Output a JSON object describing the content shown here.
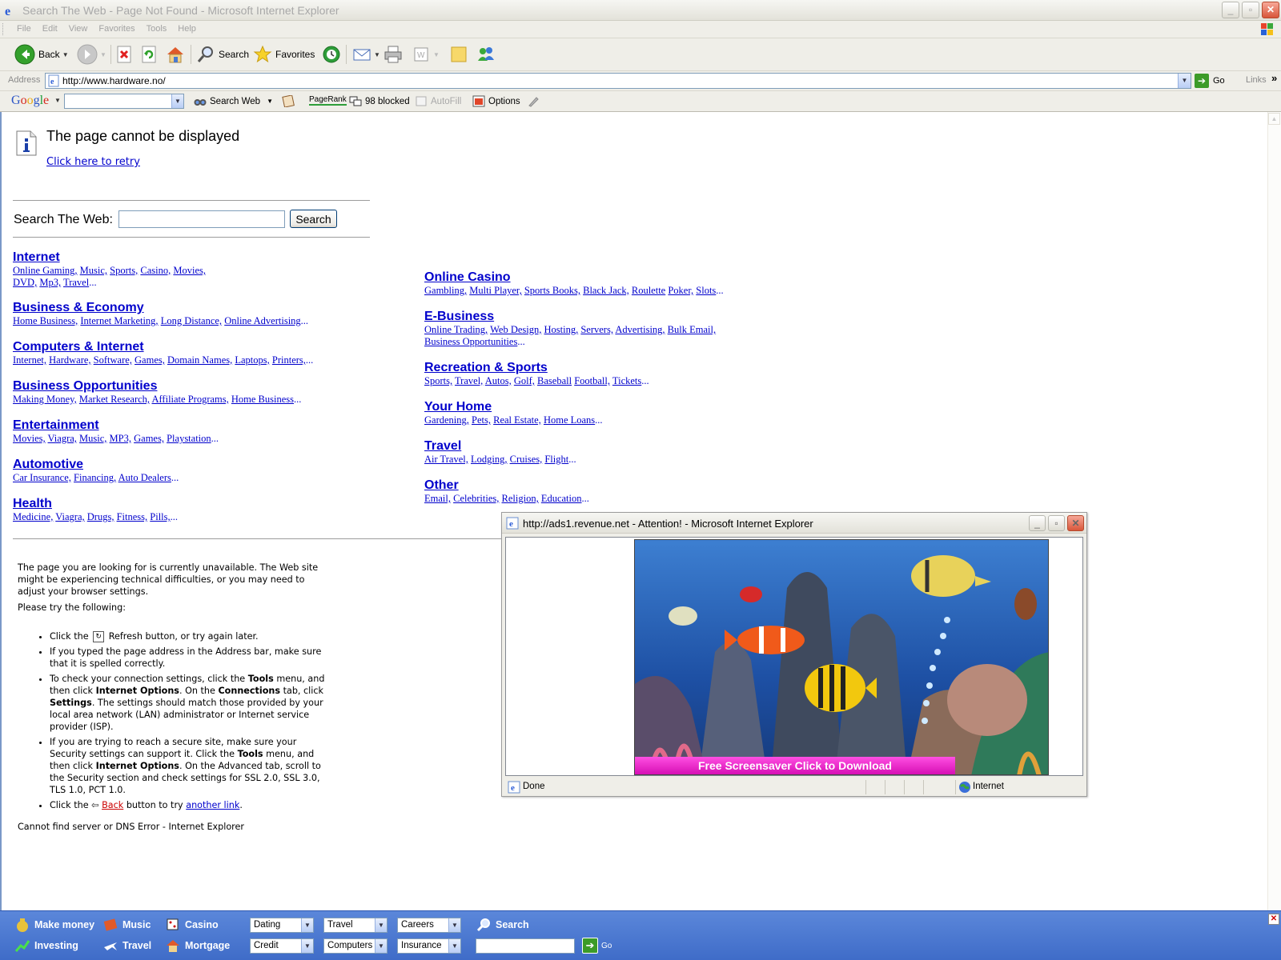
{
  "window": {
    "title": "Search The Web - Page Not Found - Microsoft Internet Explorer"
  },
  "menubar": {
    "items": [
      "File",
      "Edit",
      "View",
      "Favorites",
      "Tools",
      "Help"
    ]
  },
  "toolbar": {
    "back_label": "Back",
    "search_label": "Search",
    "favorites_label": "Favorites"
  },
  "address": {
    "label": "Address",
    "url": "http://www.hardware.no/",
    "go_label": "Go",
    "links_label": "Links"
  },
  "googlebar": {
    "logo": "Google",
    "search_web_label": "Search Web",
    "pagerank_label": "PageRank",
    "blocked_label": "98 blocked",
    "autofill_label": "AutoFill",
    "options_label": "Options"
  },
  "page": {
    "heading": "The page cannot be displayed",
    "retry_link": "Click here to retry",
    "search_label": "Search The Web:",
    "search_button": "Search",
    "categories_left": [
      {
        "title": "Internet",
        "lines": [
          [
            "Online Gaming,",
            "Music,",
            "Sports,",
            "Casino,",
            "Movies,"
          ],
          [
            "DVD,",
            "Mp3,",
            "Travel"
          ]
        ]
      },
      {
        "title": "Business & Economy",
        "lines": [
          [
            "Home Business,",
            "Internet Marketing,",
            "Long Distance,",
            "Online Advertising"
          ]
        ]
      },
      {
        "title": "Computers & Internet",
        "lines": [
          [
            "Internet,",
            "Hardware,",
            "Software,",
            "Games,",
            "Domain Names,",
            "Laptops,",
            "Printers,"
          ]
        ]
      },
      {
        "title": "Business Opportunities",
        "lines": [
          [
            "Making Money,",
            "Market Research,",
            "Affiliate Programs,",
            "Home Business"
          ]
        ]
      },
      {
        "title": "Entertainment",
        "lines": [
          [
            "Movies,",
            "Viagra,",
            "Music,",
            "MP3,",
            "Games,",
            "Playstation"
          ]
        ]
      },
      {
        "title": "Automotive",
        "lines": [
          [
            "Car Insurance,",
            "Financing,",
            "Auto Dealers"
          ]
        ]
      },
      {
        "title": "Health",
        "lines": [
          [
            "Medicine,",
            "Viagra,",
            "Drugs,",
            "Fitness,",
            "Pills,"
          ]
        ]
      }
    ],
    "categories_right": [
      {
        "title": "Online Casino",
        "lines": [
          [
            "Gambling,",
            "Multi Player,",
            "Sports Books,",
            "Black Jack,",
            "Roulette",
            "Poker,",
            "Slots"
          ]
        ]
      },
      {
        "title": "E-Business",
        "lines": [
          [
            "Online Trading,",
            "Web Design,",
            "Hosting,",
            "Servers,",
            "Advertising,",
            "Bulk Email,"
          ],
          [
            "Business Opportunities"
          ]
        ]
      },
      {
        "title": "Recreation & Sports",
        "lines": [
          [
            "Sports,",
            "Travel,",
            "Autos,",
            "Golf,",
            "Baseball",
            "Football,",
            "Tickets"
          ]
        ]
      },
      {
        "title": "Your Home",
        "lines": [
          [
            "Gardening,",
            "Pets,",
            "Real Estate,",
            "Home Loans"
          ]
        ]
      },
      {
        "title": "Travel",
        "lines": [
          [
            "Air Travel,",
            "Lodging,",
            "Cruises,",
            "Flight"
          ]
        ]
      },
      {
        "title": "Other",
        "lines": [
          [
            "Email,",
            "Celebrities,",
            "Religion,",
            "Education"
          ]
        ]
      }
    ],
    "ellipsis": "...",
    "unavailable_text": "The page you are looking for is currently unavailable. The Web site might be experiencing technical difficulties, or you may need to adjust your browser settings.",
    "try_following": "Please try the following:",
    "tip1_pre": "Click the",
    "tip1_post": "Refresh button, or try again later.",
    "tip2": "If you typed the page address in the Address bar, make sure that it is spelled correctly.",
    "tip3_a": "To check your connection settings, click the",
    "tip3_tools": "Tools",
    "tip3_b": "menu, and then click",
    "tip3_options": "Internet Options",
    "tip3_c": ". On the",
    "tip3_connections": "Connections",
    "tip3_d": "tab, click",
    "tip3_settings": "Settings",
    "tip3_e": ". The settings should match those provided by your local area network (LAN) administrator or Internet service provider (ISP).",
    "tip4_a": "If you are trying to reach a secure site, make sure your Security settings can support it. Click the",
    "tip4_tools": "Tools",
    "tip4_b": "menu, and then click",
    "tip4_options": "Internet Options",
    "tip4_c": ". On the Advanced tab, scroll to the Security section and check settings for SSL 2.0, SSL 3.0, TLS 1.0, PCT 1.0.",
    "tip5_pre": "Click the",
    "tip5_back": "Back",
    "tip5_mid": "button to try",
    "tip5_link": "another link",
    "tip5_post": ".",
    "footer_error": "Cannot find server or DNS Error - Internet Explorer"
  },
  "popup": {
    "title": "http://ads1.revenue.net - Attention! - Microsoft Internet Explorer",
    "ad_banner": "Free Screensaver Click to Download",
    "status_done": "Done",
    "status_zone": "Internet"
  },
  "bottombar": {
    "row1": [
      "Make money",
      "Music",
      "Casino"
    ],
    "row2": [
      "Investing",
      "Travel",
      "Mortgage"
    ],
    "selects_row1": [
      "Dating",
      "Travel",
      "Careers"
    ],
    "selects_row2": [
      "Credit",
      "Computers",
      "Insurance"
    ],
    "search_label": "Search",
    "go_label": "Go"
  }
}
